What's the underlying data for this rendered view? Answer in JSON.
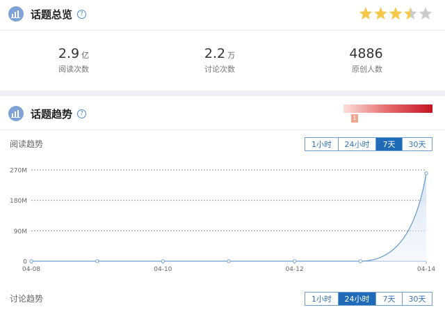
{
  "overview": {
    "title": "话题总览",
    "help": "?",
    "rating": 3.5,
    "rating_max": 5,
    "stats": [
      {
        "value": "2.9",
        "unit": "亿",
        "label": "阅读次数"
      },
      {
        "value": "2.2",
        "unit": "万",
        "label": "讨论次数"
      },
      {
        "value": "4886",
        "unit": "",
        "label": "原创人数"
      }
    ]
  },
  "trend": {
    "title": "话题趋势",
    "help": "?",
    "heat_level": "1",
    "read_section": {
      "label": "阅读趋势",
      "ranges": [
        "1小时",
        "24小时",
        "7天",
        "30天"
      ],
      "active": 2
    },
    "discuss_section": {
      "label": "讨论趋势",
      "ranges": [
        "1小时",
        "24小时",
        "7天",
        "30天"
      ],
      "active": 1
    }
  },
  "colors": {
    "accent": "#1f6bb8",
    "line": "#6d9ed2",
    "star_on": "#f5c84a",
    "star_off": "#cccccc"
  },
  "chart_data": {
    "type": "area",
    "x": [
      "04-08",
      "04-09",
      "04-10",
      "04-11",
      "04-12",
      "04-13",
      "04-14"
    ],
    "x_tick_labels": [
      "04-08",
      "04-10",
      "04-12",
      "04-14"
    ],
    "values": [
      0,
      0,
      0,
      0,
      0,
      0,
      260
    ],
    "y_ticks": [
      0,
      90,
      180,
      270
    ],
    "y_tick_labels": [
      "0",
      "90M",
      "180M",
      "270M"
    ],
    "ylim": [
      0,
      270
    ],
    "grid": true
  }
}
